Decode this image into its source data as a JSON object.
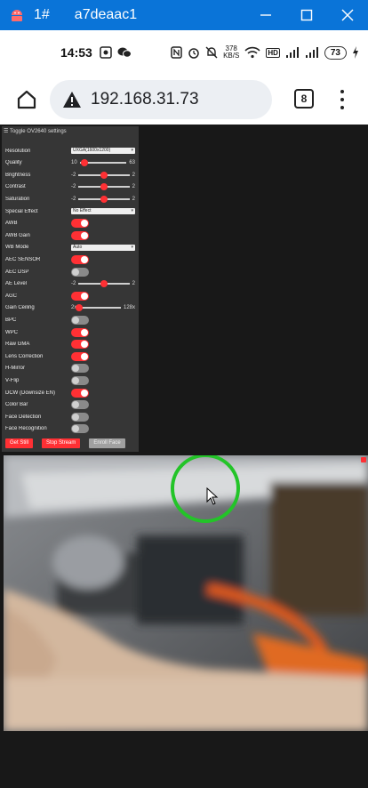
{
  "window": {
    "number": "1#",
    "title": "a7deaac1"
  },
  "status_bar": {
    "time": "14:53",
    "network_speed_value": "378",
    "network_speed_unit": "KB/S",
    "hd_label": "HD",
    "battery": "73"
  },
  "browser": {
    "url": "192.168.31.73",
    "tab_count": "8"
  },
  "settings": {
    "toggle_label": "Toggle OV2640 settings",
    "rows": [
      {
        "label": "Resolution",
        "type": "select",
        "value": "UXGA(1600x1200)"
      },
      {
        "label": "Quality",
        "type": "slider",
        "min": "10",
        "max": "63",
        "value": 0.1
      },
      {
        "label": "Brightness",
        "type": "slider",
        "min": "-2",
        "max": "2",
        "value": 0.5
      },
      {
        "label": "Contrast",
        "type": "slider",
        "min": "-2",
        "max": "2",
        "value": 0.5
      },
      {
        "label": "Saturation",
        "type": "slider",
        "min": "-2",
        "max": "2",
        "value": 0.5
      },
      {
        "label": "Special Effect",
        "type": "select",
        "value": "No Effect"
      },
      {
        "label": "AWB",
        "type": "toggle",
        "on": true
      },
      {
        "label": "AWB Gain",
        "type": "toggle",
        "on": true
      },
      {
        "label": "WB Mode",
        "type": "select",
        "value": "Auto"
      },
      {
        "label": "AEC SENSOR",
        "type": "toggle",
        "on": true
      },
      {
        "label": "AEC DSP",
        "type": "toggle",
        "on": false
      },
      {
        "label": "AE Level",
        "type": "slider",
        "min": "-2",
        "max": "2",
        "value": 0.5
      },
      {
        "label": "AGC",
        "type": "toggle",
        "on": true
      },
      {
        "label": "Gain Ceiling",
        "type": "slider",
        "min": "2x",
        "max": "128x",
        "value": 0.0
      },
      {
        "label": "BPC",
        "type": "toggle",
        "on": false
      },
      {
        "label": "WPC",
        "type": "toggle",
        "on": true
      },
      {
        "label": "Raw GMA",
        "type": "toggle",
        "on": true
      },
      {
        "label": "Lens Correction",
        "type": "toggle",
        "on": true
      },
      {
        "label": "H-Mirror",
        "type": "toggle",
        "on": false
      },
      {
        "label": "V-Flip",
        "type": "toggle",
        "on": false
      },
      {
        "label": "DCW (Downsize EN)",
        "type": "toggle",
        "on": true
      },
      {
        "label": "Color Bar",
        "type": "toggle",
        "on": false
      },
      {
        "label": "Face Detection",
        "type": "toggle",
        "on": false
      },
      {
        "label": "Face Recognition",
        "type": "toggle",
        "on": false
      }
    ],
    "buttons": {
      "get_still": "Get Still",
      "stop_stream": "Stop Stream",
      "enroll_face": "Enroll Face"
    }
  },
  "colors": {
    "accent": "#ff3034",
    "titlebar": "#0a74d8",
    "panel": "#363636",
    "ring": "#23c428"
  }
}
